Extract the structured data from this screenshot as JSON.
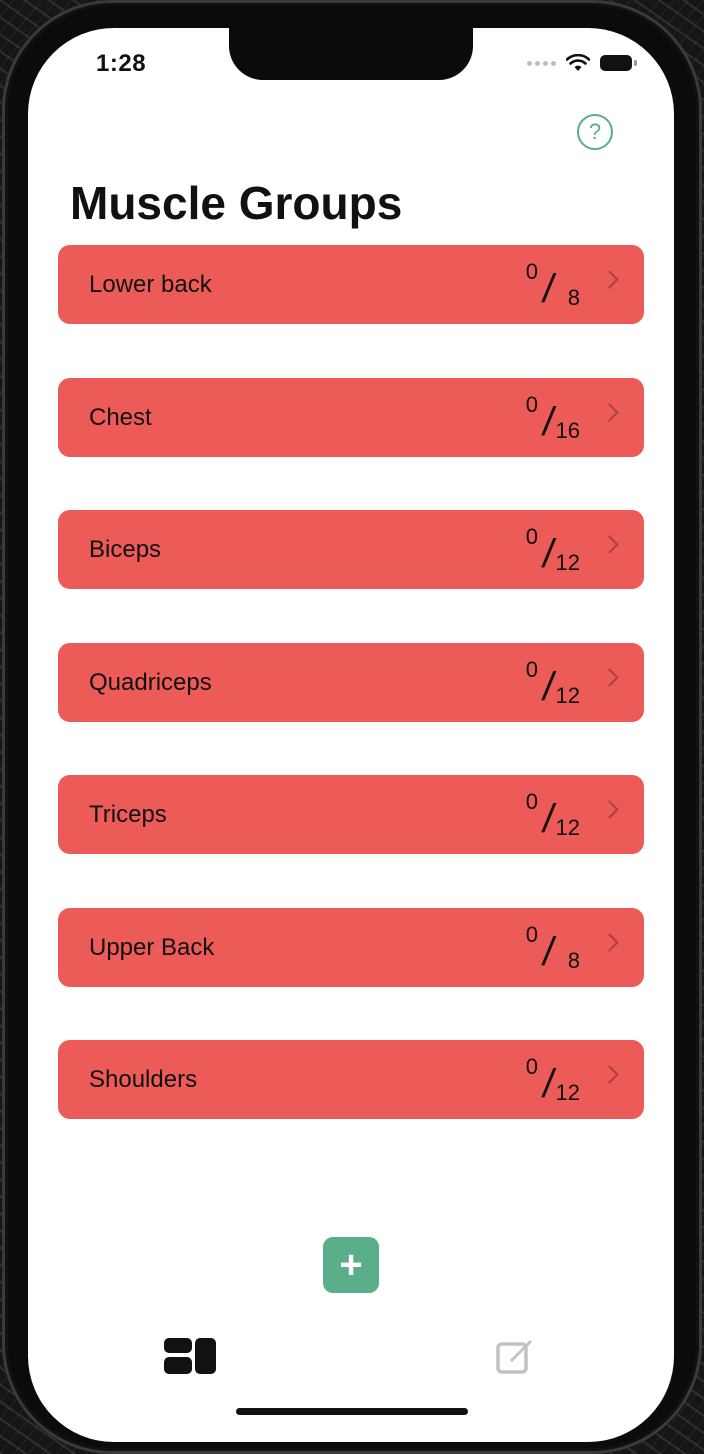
{
  "status_bar": {
    "time": "1:28"
  },
  "header": {
    "title": "Muscle Groups",
    "help_icon": "question-circle-icon",
    "help_glyph": "?"
  },
  "muscle_groups": [
    {
      "label": "Lower back",
      "completed": "0",
      "total": "8"
    },
    {
      "label": "Chest",
      "completed": "0",
      "total": "16"
    },
    {
      "label": "Biceps",
      "completed": "0",
      "total": "12"
    },
    {
      "label": "Quadriceps",
      "completed": "0",
      "total": "12"
    },
    {
      "label": "Triceps",
      "completed": "0",
      "total": "12"
    },
    {
      "label": "Upper Back",
      "completed": "0",
      "total": "8"
    },
    {
      "label": "Shoulders",
      "completed": "0",
      "total": "12"
    }
  ],
  "add_button": {
    "icon": "plus-icon",
    "glyph": "+"
  },
  "tab_bar": {
    "tabs": [
      {
        "icon": "dashboard-icon",
        "selected": true
      },
      {
        "icon": "edit-icon",
        "selected": false
      }
    ]
  },
  "colors": {
    "row_background": "#ec5b58",
    "accent": "#5aae8a",
    "text": "#111111"
  }
}
